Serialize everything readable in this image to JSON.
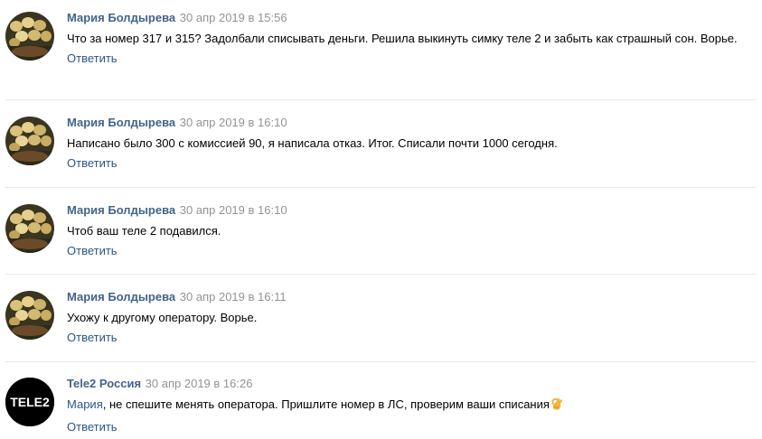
{
  "comments": [
    {
      "author": "Мария Болдырева",
      "date": "30 апр 2019 в 15:56",
      "text": "Что за номер 317 и 315? Задолбали списывать деньги. Решила выкинуть симку теле 2 и забыть как страшный сон. Ворье.",
      "reply_label": "Ответить",
      "avatar_icon": "tulips-photo"
    },
    {
      "author": "Мария Болдырева",
      "date": "30 апр 2019 в 16:10",
      "text": "Написано было 300 с комиссией 90, я написала отказ. Итог. Списали почти 1000 сегодня.",
      "reply_label": "Ответить",
      "avatar_icon": "tulips-photo"
    },
    {
      "author": "Мария Болдырева",
      "date": "30 апр 2019 в 16:10",
      "text": "Чтоб ваш теле 2 подавился.",
      "reply_label": "Ответить",
      "avatar_icon": "tulips-photo"
    },
    {
      "author": "Мария Болдырева",
      "date": "30 апр 2019 в 16:11",
      "text": "Ухожу к другому оператору. Ворье.",
      "reply_label": "Ответить",
      "avatar_icon": "tulips-photo"
    },
    {
      "author": "Tele2 Россия",
      "date": "30 апр 2019 в 16:26",
      "mention": "Мария",
      "text": ", не спешите менять оператора. Пришлите номер в ЛС, проверим ваши списания",
      "reply_label": "Ответить",
      "avatar_icon": "tele2-logo",
      "avatar_logo_text": "TELE2",
      "emoji": "ok-hand-emoji"
    }
  ],
  "colors": {
    "author": "#42648b",
    "date": "#939393",
    "link": "#2a5885",
    "divider": "#e7e8ec"
  }
}
